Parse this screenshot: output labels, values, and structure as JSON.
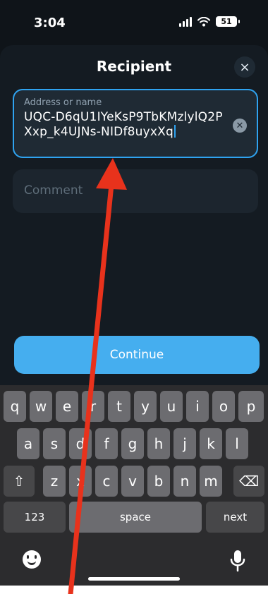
{
  "status_bar": {
    "time": "3:04",
    "battery": "51"
  },
  "sheet": {
    "title": "Recipient",
    "close_icon": "×"
  },
  "address_field": {
    "label": "Address or name",
    "value": "UQC-D6qU1IYeKsP9TbKMzlylQ2PXxp_k4UJNs-NIDf8uyxXq",
    "clear_icon": "✕"
  },
  "comment_field": {
    "placeholder": "Comment"
  },
  "continue_button": {
    "label": "Continue"
  },
  "keyboard": {
    "row1": [
      "q",
      "w",
      "e",
      "r",
      "t",
      "y",
      "u",
      "i",
      "o",
      "p"
    ],
    "row2": [
      "a",
      "s",
      "d",
      "f",
      "g",
      "h",
      "j",
      "k",
      "l"
    ],
    "row3": [
      "z",
      "x",
      "c",
      "v",
      "b",
      "n",
      "m"
    ],
    "shift_icon": "⇧",
    "backspace_icon": "⌫",
    "numbers_label": "123",
    "space_label": "space",
    "next_label": "next"
  },
  "colors": {
    "accent": "#45aeef",
    "annotation": "#e8321c"
  }
}
